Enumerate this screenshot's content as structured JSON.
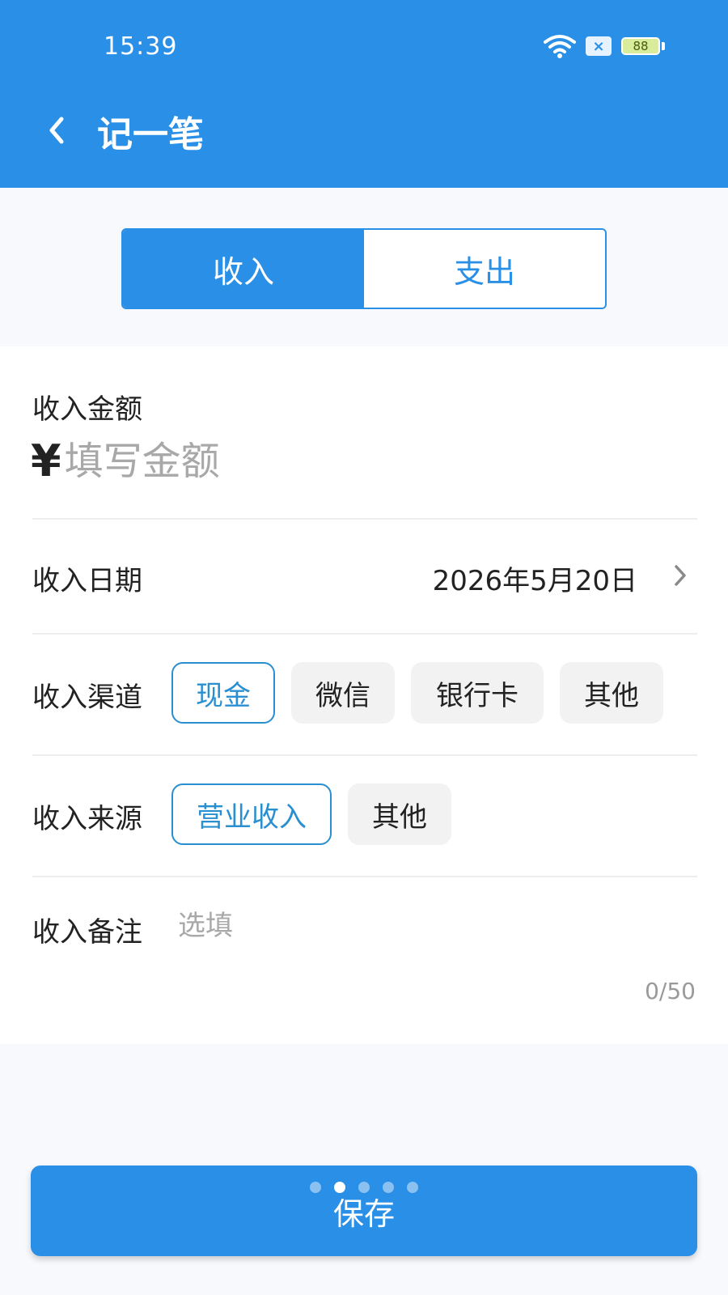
{
  "status_bar": {
    "time": "15:39",
    "battery_level": "88"
  },
  "header": {
    "title": "记一笔"
  },
  "tabs": [
    {
      "label": "收入",
      "active": true
    },
    {
      "label": "支出",
      "active": false
    }
  ],
  "form": {
    "amount": {
      "label": "收入金额",
      "currency_symbol": "¥",
      "placeholder": "填写金额",
      "value": ""
    },
    "date": {
      "label": "收入日期",
      "value": "2026年5月20日"
    },
    "channel": {
      "label": "收入渠道",
      "options": [
        "现金",
        "微信",
        "银行卡",
        "其他"
      ],
      "selected": "现金"
    },
    "source": {
      "label": "收入来源",
      "options": [
        "营业收入",
        "其他"
      ],
      "selected": "营业收入"
    },
    "note": {
      "label": "收入备注",
      "placeholder": "选填",
      "counter": "0/50"
    }
  },
  "save_button": {
    "label": "保存"
  },
  "page_indicator": {
    "total": 5,
    "current": 2
  },
  "colors": {
    "primary": "#2a8fe6",
    "chip_selected_border": "#2a8fd0",
    "chip_bg": "#f2f2f2",
    "placeholder": "#a8a8a8"
  }
}
